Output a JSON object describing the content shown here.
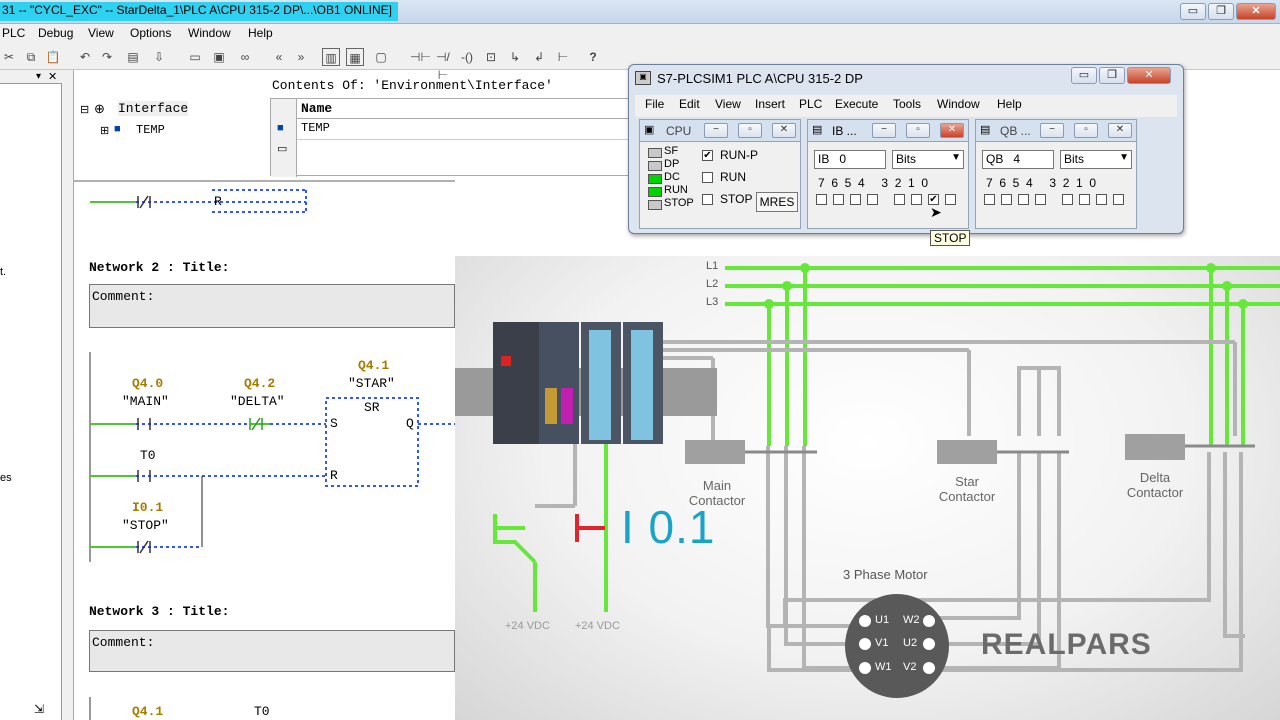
{
  "window": {
    "title": "31 -- \"CYCL_EXC\" -- StarDelta_1\\PLC A\\CPU 315-2 DP\\...\\OB1  ONLINE]",
    "controls": [
      "▭",
      "❐",
      "✕"
    ]
  },
  "menubar": [
    "PLC",
    "Debug",
    "View",
    "Options",
    "Window",
    "Help"
  ],
  "interface": {
    "contents_header": "Contents Of: 'Environment\\Interface'",
    "tree_root": "Interface",
    "tree_child": "TEMP",
    "column_name": "Name",
    "row_1": "TEMP"
  },
  "left_fragments": [
    "t.",
    "es"
  ],
  "editor": {
    "network1_coil": "R",
    "network2_title": "Network 2 : Title:",
    "network2_comment": "Comment:",
    "q40_addr": "Q4.0",
    "q40_name": "\"MAIN\"",
    "q42_addr": "Q4.2",
    "q42_name": "\"DELTA\"",
    "q41_addr": "Q4.1",
    "q41_name": "\"STAR\"",
    "sr_label": "SR",
    "s_pin": "S",
    "q_pin": "Q",
    "r_pin": "R",
    "t0": "T0",
    "i01_addr": "I0.1",
    "i01_name": "\"STOP\"",
    "network3_title": "Network 3 : Title:",
    "network3_comment": "Comment:",
    "n3_q41": "Q4.1",
    "n3_t0": "T0"
  },
  "plcsim": {
    "title": "S7-PLCSIM1    PLC A\\CPU 315-2 DP",
    "menu": [
      "File",
      "Edit",
      "View",
      "Insert",
      "PLC",
      "Execute",
      "Tools",
      "Window",
      "Help"
    ],
    "cpu": {
      "title": "CPU",
      "leds": [
        "SF",
        "DP",
        "DC",
        "RUN",
        "STOP"
      ],
      "leds_on": [
        false,
        false,
        true,
        true,
        false
      ],
      "modes": [
        "RUN-P",
        "RUN",
        "STOP"
      ],
      "mode_checked": [
        true,
        false,
        false
      ],
      "mres": "MRES"
    },
    "ib": {
      "title": "IB  ...",
      "area": "IB",
      "address": "0",
      "format": "Bits",
      "bit_labels": "7  6  5  4     3  2  1  0",
      "bits_checked": [
        false,
        false,
        false,
        false,
        false,
        false,
        true,
        false
      ]
    },
    "qb": {
      "title": "QB  ...",
      "area": "QB",
      "address": "4",
      "format": "Bits",
      "bit_labels": "7  6  5  4     3  2  1  0",
      "bits_checked": [
        false,
        false,
        false,
        false,
        false,
        false,
        false,
        false
      ]
    },
    "tooltip": "STOP"
  },
  "diagram": {
    "lines": [
      "L1",
      "L2",
      "L3"
    ],
    "main_contactor": "Main\nContactor",
    "star_contactor": "Star\nContactor",
    "delta_contactor": "Delta\nContactor",
    "motor_title": "3 Phase Motor",
    "terminals": [
      "U1",
      "W2",
      "V1",
      "U2",
      "W1",
      "V2"
    ],
    "supply_1": "+24 VDC",
    "supply_2": "+24 VDC",
    "input_label": "I 0.1",
    "brand": "REALPARS",
    "colors": {
      "live": "#66e83a",
      "wire": "#b4b4b4",
      "accent": "#1aa3c9",
      "stop": "#e0262c"
    }
  }
}
